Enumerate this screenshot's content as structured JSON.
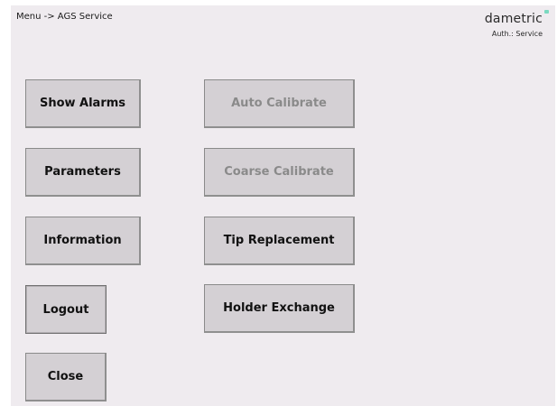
{
  "header": {
    "breadcrumb": "Menu -> AGS Service",
    "brand": "dametric",
    "auth": "Auth.: Service"
  },
  "buttons": {
    "show_alarms": "Show Alarms",
    "parameters": "Parameters",
    "information": "Information",
    "logout": "Logout",
    "close": "Close",
    "auto_calibrate": "Auto Calibrate",
    "coarse_calibrate": "Coarse Calibrate",
    "tip_replacement": "Tip Replacement",
    "holder_exchange": "Holder Exchange"
  },
  "colors": {
    "background": "#efebef",
    "button": "#d4d0d4",
    "disabled_text": "#8a8a8a",
    "brand_accent": "#7bd9c0"
  }
}
